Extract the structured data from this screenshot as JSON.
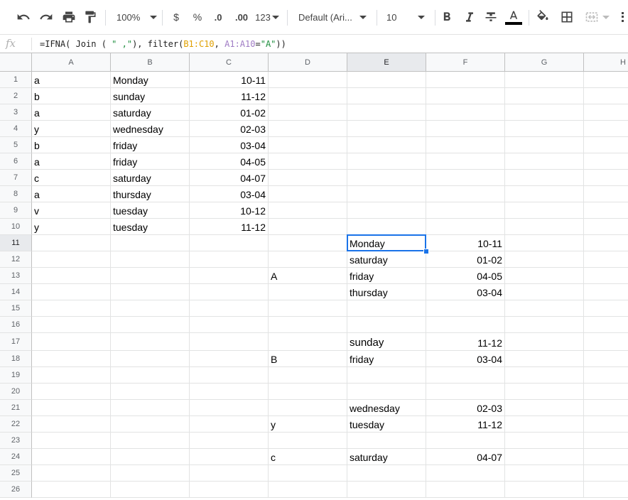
{
  "toolbar": {
    "zoom": "100%",
    "currency": "$",
    "percent": "%",
    "decrease_decimals": ".0",
    "increase_decimals": ".00",
    "more_formats": "123",
    "font": "Default (Ari...",
    "font_size": "10",
    "text_color_accent": "#000000"
  },
  "formula_bar": {
    "fx_label": "fx",
    "parts": [
      "=IFNA( Join (",
      "\" ,\"",
      "), filter(",
      "B1:C10",
      ", ",
      "A1:A10",
      "=",
      "\"A\"",
      "))"
    ]
  },
  "sheet": {
    "columns": [
      "A",
      "B",
      "C",
      "D",
      "E",
      "F",
      "G",
      "H"
    ],
    "selected_column": "E",
    "selected_row": 11,
    "rows": [
      1,
      2,
      3,
      4,
      5,
      6,
      7,
      8,
      9,
      10,
      11,
      12,
      13,
      14,
      15,
      16,
      17,
      18,
      19,
      20,
      21,
      22,
      23,
      24,
      25,
      26
    ],
    "colA": [
      "a",
      "b",
      "a",
      "y",
      "b",
      "a",
      "c",
      "a",
      "v",
      "y"
    ],
    "colB": [
      "Monday",
      "sunday",
      "saturday",
      "wednesday",
      "friday",
      "friday",
      "saturday",
      "thursday",
      "tuesday",
      "tuesday"
    ],
    "colC": [
      "10-11",
      "11-12",
      "01-02",
      "02-03",
      "03-04",
      "04-05",
      "04-07",
      "03-04",
      "10-12",
      "11-12"
    ],
    "results": [
      {
        "row": 11,
        "d": "",
        "e": "Monday",
        "f": "10-11"
      },
      {
        "row": 12,
        "d": "",
        "e": "saturday",
        "f": "01-02"
      },
      {
        "row": 13,
        "d": "A",
        "e": "friday",
        "f": "04-05"
      },
      {
        "row": 14,
        "d": "",
        "e": "thursday",
        "f": "03-04"
      },
      {
        "row": 17,
        "d": "",
        "e": "sunday",
        "f": "11-12"
      },
      {
        "row": 18,
        "d": "B",
        "e": "friday",
        "f": "03-04"
      },
      {
        "row": 21,
        "d": "",
        "e": "wednesday",
        "f": "02-03"
      },
      {
        "row": 22,
        "d": "y",
        "e": "tuesday",
        "f": "11-12"
      },
      {
        "row": 24,
        "d": "c",
        "e": "saturday",
        "f": "04-07"
      }
    ]
  },
  "colors": {
    "selection": "#1a73e8",
    "gridline": "#e2e3e3",
    "header_bg": "#f8f9fa"
  }
}
